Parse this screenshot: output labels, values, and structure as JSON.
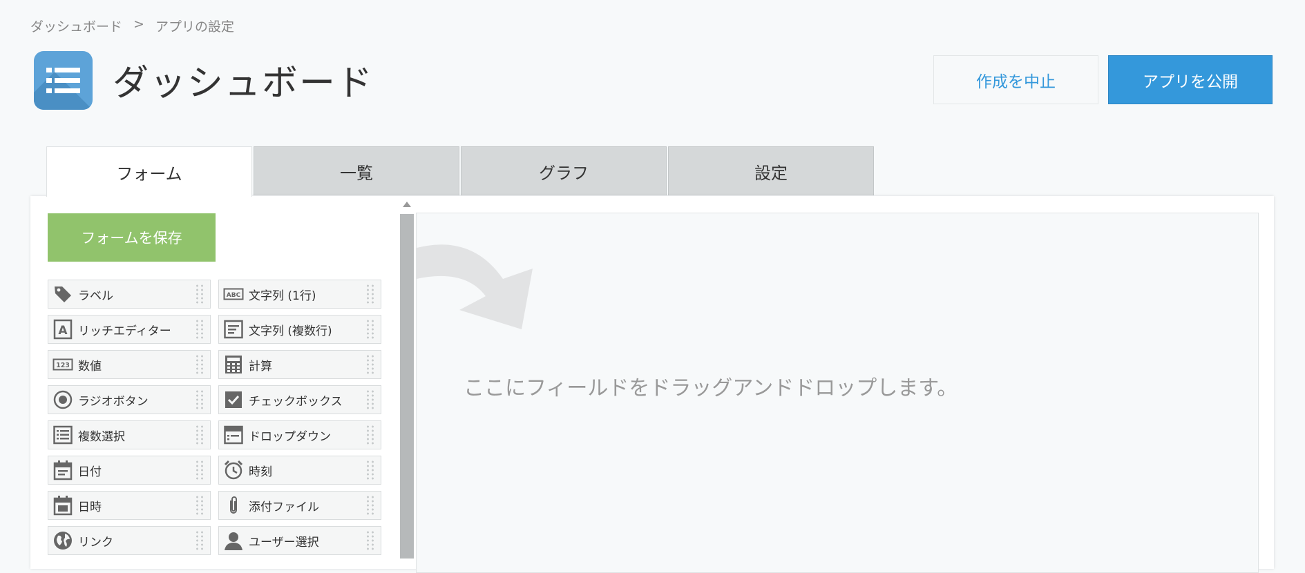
{
  "breadcrumb": {
    "home": "ダッシュボード",
    "separator": ">",
    "current": "アプリの設定"
  },
  "header": {
    "title": "ダッシュボード",
    "cancel_label": "作成を中止",
    "publish_label": "アプリを公開"
  },
  "tabs": [
    {
      "label": "フォーム",
      "active": true
    },
    {
      "label": "一覧",
      "active": false
    },
    {
      "label": "グラフ",
      "active": false
    },
    {
      "label": "設定",
      "active": false
    }
  ],
  "form": {
    "save_label": "フォームを保存",
    "drop_hint": "ここにフィールドをドラッグアンドドロップします。"
  },
  "fields": [
    {
      "label": "ラベル",
      "icon": "tag-icon"
    },
    {
      "label": "文字列 (1行)",
      "icon": "abc-icon"
    },
    {
      "label": "リッチエディター",
      "icon": "rich-editor-icon"
    },
    {
      "label": "文字列 (複数行)",
      "icon": "multiline-text-icon"
    },
    {
      "label": "数値",
      "icon": "number-icon"
    },
    {
      "label": "計算",
      "icon": "calculator-icon"
    },
    {
      "label": "ラジオボタン",
      "icon": "radio-icon"
    },
    {
      "label": "チェックボックス",
      "icon": "checkbox-icon"
    },
    {
      "label": "複数選択",
      "icon": "multi-select-icon"
    },
    {
      "label": "ドロップダウン",
      "icon": "dropdown-icon"
    },
    {
      "label": "日付",
      "icon": "date-icon"
    },
    {
      "label": "時刻",
      "icon": "clock-icon"
    },
    {
      "label": "日時",
      "icon": "datetime-icon"
    },
    {
      "label": "添付ファイル",
      "icon": "paperclip-icon"
    },
    {
      "label": "リンク",
      "icon": "globe-icon"
    },
    {
      "label": "ユーザー選択",
      "icon": "user-icon"
    }
  ],
  "colors": {
    "accent": "#3498db",
    "save": "#91c36c",
    "icon_gray": "#666666",
    "app_icon": "#5da3d8"
  }
}
